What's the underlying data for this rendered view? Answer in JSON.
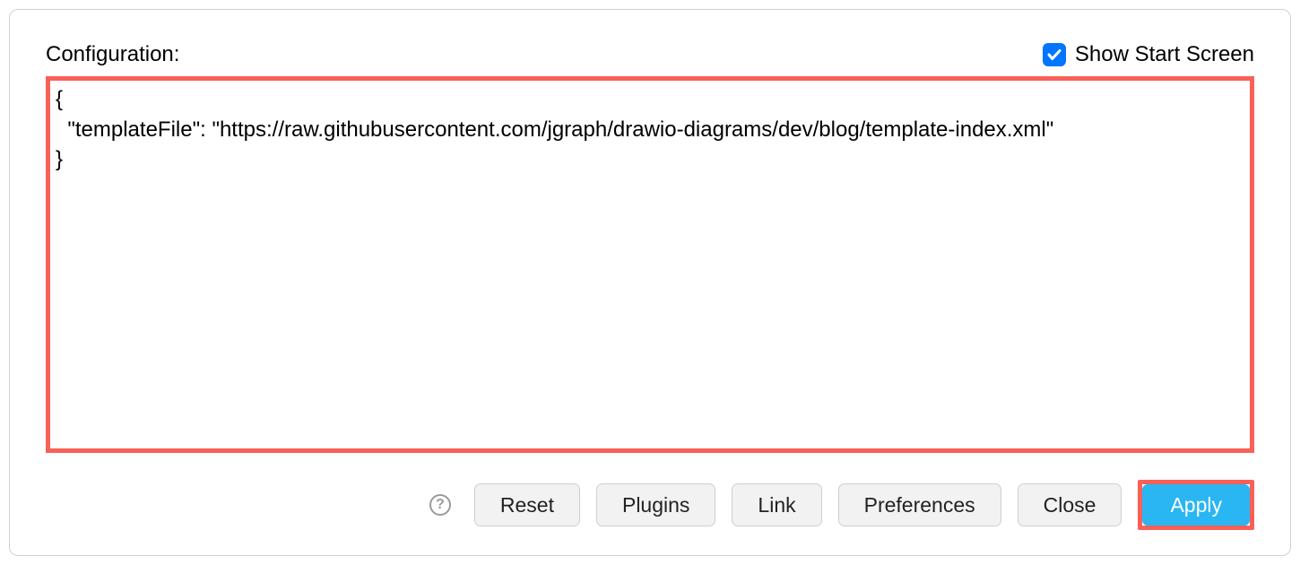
{
  "header": {
    "config_label": "Configuration:",
    "show_start_label": "Show Start Screen",
    "show_start_checked": true
  },
  "config_text": "{\n  \"templateFile\": \"https://raw.githubusercontent.com/jgraph/drawio-diagrams/dev/blog/template-index.xml\"\n}",
  "help_glyph": "?",
  "buttons": {
    "reset": "Reset",
    "plugins": "Plugins",
    "link": "Link",
    "preferences": "Preferences",
    "close": "Close",
    "apply": "Apply"
  },
  "colors": {
    "highlight": "#f96057",
    "primary": "#29b6f2",
    "checkbox": "#0075ff"
  }
}
